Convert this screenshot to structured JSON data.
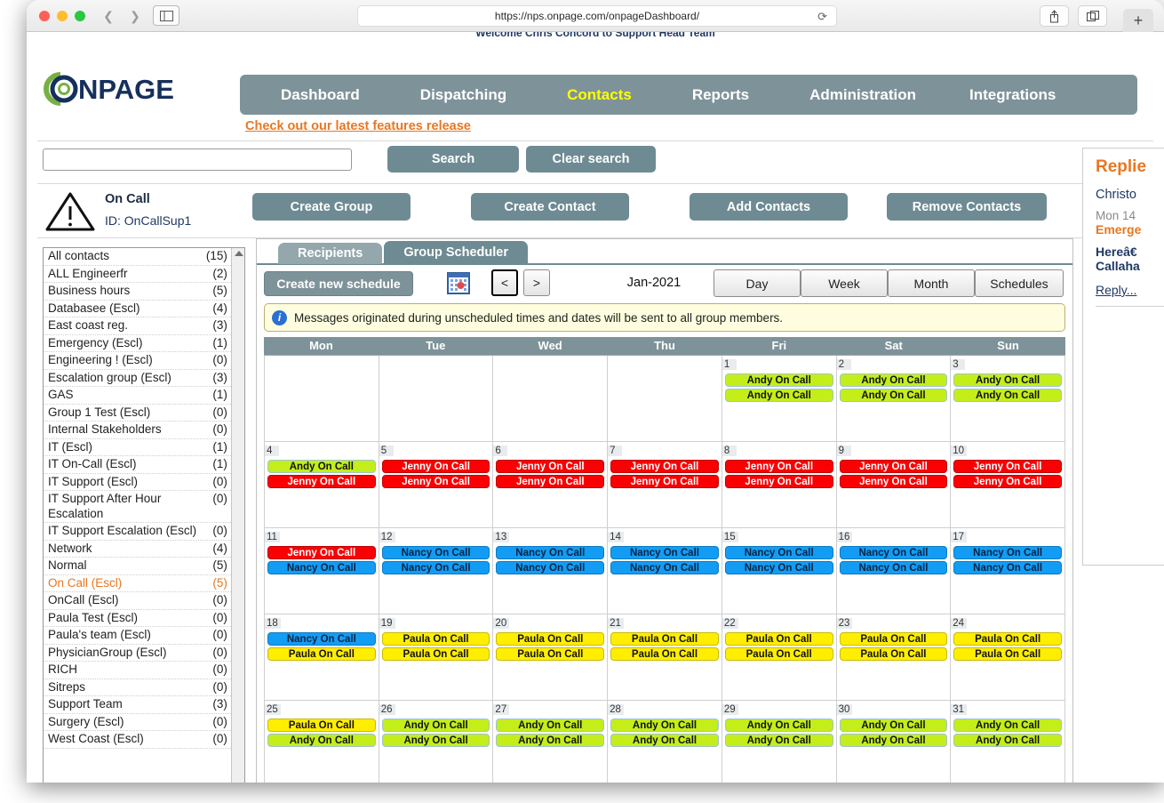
{
  "browser": {
    "url": "https://nps.onpage.com/onpageDashboard/",
    "back_icon": "chevron-left-icon",
    "forward_icon": "chevron-right-icon",
    "sidebar_icon": "sidebar-toggle-icon",
    "reload_icon": "reload-icon",
    "share_icon": "share-icon",
    "tabs_icon": "tab-overview-icon",
    "new_tab_label": "+"
  },
  "header": {
    "logo_text": "ONPAGE",
    "features_link": "Check out our latest features release",
    "nav": [
      {
        "label": "Dashboard",
        "active": false
      },
      {
        "label": "Dispatching",
        "active": false
      },
      {
        "label": "Contacts",
        "active": true
      },
      {
        "label": "Reports",
        "active": false
      },
      {
        "label": "Administration",
        "active": false
      },
      {
        "label": "Integrations",
        "active": false
      }
    ]
  },
  "search": {
    "value": "",
    "placeholder": "",
    "search_label": "Search",
    "clear_label": "Clear search"
  },
  "group_header": {
    "warning_icon": "warning-triangle-icon",
    "name": "On Call",
    "id": "ID: OnCallSup1",
    "buttons": [
      {
        "label": "Create Group"
      },
      {
        "label": "Create Contact"
      },
      {
        "label": "Add Contacts"
      },
      {
        "label": "Remove Contacts"
      }
    ]
  },
  "group_list": [
    {
      "name": "All contacts",
      "count": "(15)",
      "selected": false
    },
    {
      "name": "ALL Engineerfr",
      "count": "(2)",
      "selected": false
    },
    {
      "name": "Business hours",
      "count": "(5)",
      "selected": false
    },
    {
      "name": "Databasee (Escl)",
      "count": "(4)",
      "selected": false
    },
    {
      "name": "East coast reg.",
      "count": "(3)",
      "selected": false
    },
    {
      "name": "Emergency (Escl)",
      "count": "(1)",
      "selected": false
    },
    {
      "name": "Engineering ! (Escl)",
      "count": "(0)",
      "selected": false
    },
    {
      "name": "Escalation group (Escl)",
      "count": "(3)",
      "selected": false
    },
    {
      "name": "GAS",
      "count": "(1)",
      "selected": false
    },
    {
      "name": "Group 1 Test (Escl)",
      "count": "(0)",
      "selected": false
    },
    {
      "name": "Internal Stakeholders",
      "count": "(0)",
      "selected": false
    },
    {
      "name": "IT (Escl)",
      "count": "(1)",
      "selected": false
    },
    {
      "name": "IT On-Call (Escl)",
      "count": "(1)",
      "selected": false
    },
    {
      "name": "IT Support (Escl)",
      "count": "(0)",
      "selected": false
    },
    {
      "name": "IT Support After Hour Escalation",
      "count": "(0)",
      "selected": false
    },
    {
      "name": "IT Support Escalation (Escl)",
      "count": "(0)",
      "selected": false
    },
    {
      "name": "Network",
      "count": "(4)",
      "selected": false
    },
    {
      "name": "Normal",
      "count": "(5)",
      "selected": false
    },
    {
      "name": "On Call (Escl)",
      "count": "(5)",
      "selected": true
    },
    {
      "name": "OnCall (Escl)",
      "count": "(0)",
      "selected": false
    },
    {
      "name": "Paula Test (Escl)",
      "count": "(0)",
      "selected": false
    },
    {
      "name": "Paula's team (Escl)",
      "count": "(0)",
      "selected": false
    },
    {
      "name": "PhysicianGroup (Escl)",
      "count": "(0)",
      "selected": false
    },
    {
      "name": "RICH",
      "count": "(0)",
      "selected": false
    },
    {
      "name": "Sitreps",
      "count": "(0)",
      "selected": false
    },
    {
      "name": "Support Team",
      "count": "(3)",
      "selected": false
    },
    {
      "name": "Surgery (Escl)",
      "count": "(0)",
      "selected": false
    },
    {
      "name": "West Coast (Escl)",
      "count": "(0)",
      "selected": false
    }
  ],
  "tabs": [
    {
      "label": "Recipients",
      "active": false
    },
    {
      "label": "Group Scheduler",
      "active": true
    }
  ],
  "scheduler": {
    "create_new_schedule_label": "Create new schedule",
    "calendar_picker_icon": "calendar-picker-icon",
    "prev_label": "<",
    "next_label": ">",
    "month_label": "Jan-2021",
    "view_buttons": [
      {
        "label": "Day"
      },
      {
        "label": "Week"
      },
      {
        "label": "Month"
      },
      {
        "label": "Schedules"
      }
    ],
    "info_icon": "info-circle-icon",
    "info_text": "Messages originated during unscheduled times and dates will be sent to all group members.",
    "day_headers": [
      "Mon",
      "Tue",
      "Wed",
      "Thu",
      "Fri",
      "Sat",
      "Sun"
    ],
    "colors": {
      "andy": "#c3ee1a",
      "jenny": "#fb0003",
      "nancy": "#139cf4",
      "paula": "#ffee00",
      "header": "#7e9399",
      "accent": "#e87722"
    },
    "cells": [
      {
        "day": "",
        "events": []
      },
      {
        "day": "",
        "events": []
      },
      {
        "day": "",
        "events": []
      },
      {
        "day": "",
        "events": []
      },
      {
        "day": "1",
        "events": [
          {
            "label": "Andy On Call",
            "color": "green"
          },
          {
            "label": "Andy On Call",
            "color": "green"
          }
        ]
      },
      {
        "day": "2",
        "events": [
          {
            "label": "Andy On Call",
            "color": "green"
          },
          {
            "label": "Andy On Call",
            "color": "green"
          }
        ]
      },
      {
        "day": "3",
        "events": [
          {
            "label": "Andy On Call",
            "color": "green"
          },
          {
            "label": "Andy On Call",
            "color": "green"
          }
        ]
      },
      {
        "day": "4",
        "events": [
          {
            "label": "Andy On Call",
            "color": "green"
          },
          {
            "label": "Jenny On Call",
            "color": "red"
          }
        ]
      },
      {
        "day": "5",
        "events": [
          {
            "label": "Jenny On Call",
            "color": "red"
          },
          {
            "label": "Jenny On Call",
            "color": "red"
          }
        ]
      },
      {
        "day": "6",
        "events": [
          {
            "label": "Jenny On Call",
            "color": "red"
          },
          {
            "label": "Jenny On Call",
            "color": "red"
          }
        ]
      },
      {
        "day": "7",
        "events": [
          {
            "label": "Jenny On Call",
            "color": "red"
          },
          {
            "label": "Jenny On Call",
            "color": "red"
          }
        ]
      },
      {
        "day": "8",
        "events": [
          {
            "label": "Jenny On Call",
            "color": "red"
          },
          {
            "label": "Jenny On Call",
            "color": "red"
          }
        ]
      },
      {
        "day": "9",
        "events": [
          {
            "label": "Jenny On Call",
            "color": "red"
          },
          {
            "label": "Jenny On Call",
            "color": "red"
          }
        ]
      },
      {
        "day": "10",
        "events": [
          {
            "label": "Jenny On Call",
            "color": "red"
          },
          {
            "label": "Jenny On Call",
            "color": "red"
          }
        ]
      },
      {
        "day": "11",
        "events": [
          {
            "label": "Jenny On Call",
            "color": "red"
          },
          {
            "label": "Nancy On Call",
            "color": "blue"
          }
        ]
      },
      {
        "day": "12",
        "events": [
          {
            "label": "Nancy On Call",
            "color": "blue"
          },
          {
            "label": "Nancy On Call",
            "color": "blue"
          }
        ]
      },
      {
        "day": "13",
        "events": [
          {
            "label": "Nancy On Call",
            "color": "blue"
          },
          {
            "label": "Nancy On Call",
            "color": "blue"
          }
        ]
      },
      {
        "day": "14",
        "events": [
          {
            "label": "Nancy On Call",
            "color": "blue"
          },
          {
            "label": "Nancy On Call",
            "color": "blue"
          }
        ]
      },
      {
        "day": "15",
        "events": [
          {
            "label": "Nancy On Call",
            "color": "blue"
          },
          {
            "label": "Nancy On Call",
            "color": "blue"
          }
        ]
      },
      {
        "day": "16",
        "events": [
          {
            "label": "Nancy On Call",
            "color": "blue"
          },
          {
            "label": "Nancy On Call",
            "color": "blue"
          }
        ]
      },
      {
        "day": "17",
        "events": [
          {
            "label": "Nancy On Call",
            "color": "blue"
          },
          {
            "label": "Nancy On Call",
            "color": "blue"
          }
        ]
      },
      {
        "day": "18",
        "events": [
          {
            "label": "Nancy On Call",
            "color": "blue"
          },
          {
            "label": "Paula On Call",
            "color": "yellow"
          }
        ]
      },
      {
        "day": "19",
        "events": [
          {
            "label": "Paula On Call",
            "color": "yellow"
          },
          {
            "label": "Paula On Call",
            "color": "yellow"
          }
        ]
      },
      {
        "day": "20",
        "events": [
          {
            "label": "Paula On Call",
            "color": "yellow"
          },
          {
            "label": "Paula On Call",
            "color": "yellow"
          }
        ]
      },
      {
        "day": "21",
        "events": [
          {
            "label": "Paula On Call",
            "color": "yellow"
          },
          {
            "label": "Paula On Call",
            "color": "yellow"
          }
        ]
      },
      {
        "day": "22",
        "events": [
          {
            "label": "Paula On Call",
            "color": "yellow"
          },
          {
            "label": "Paula On Call",
            "color": "yellow"
          }
        ]
      },
      {
        "day": "23",
        "events": [
          {
            "label": "Paula On Call",
            "color": "yellow"
          },
          {
            "label": "Paula On Call",
            "color": "yellow"
          }
        ]
      },
      {
        "day": "24",
        "events": [
          {
            "label": "Paula On Call",
            "color": "yellow"
          },
          {
            "label": "Paula On Call",
            "color": "yellow"
          }
        ]
      },
      {
        "day": "25",
        "events": [
          {
            "label": "Paula On Call",
            "color": "yellow"
          },
          {
            "label": "Andy On Call",
            "color": "green"
          }
        ]
      },
      {
        "day": "26",
        "events": [
          {
            "label": "Andy On Call",
            "color": "green"
          },
          {
            "label": "Andy On Call",
            "color": "green"
          }
        ]
      },
      {
        "day": "27",
        "events": [
          {
            "label": "Andy On Call",
            "color": "green"
          },
          {
            "label": "Andy On Call",
            "color": "green"
          }
        ]
      },
      {
        "day": "28",
        "events": [
          {
            "label": "Andy On Call",
            "color": "green"
          },
          {
            "label": "Andy On Call",
            "color": "green"
          }
        ]
      },
      {
        "day": "29",
        "events": [
          {
            "label": "Andy On Call",
            "color": "green"
          },
          {
            "label": "Andy On Call",
            "color": "green"
          }
        ]
      },
      {
        "day": "30",
        "events": [
          {
            "label": "Andy On Call",
            "color": "green"
          },
          {
            "label": "Andy On Call",
            "color": "green"
          }
        ]
      },
      {
        "day": "31",
        "events": [
          {
            "label": "Andy On Call",
            "color": "green"
          },
          {
            "label": "Andy On Call",
            "color": "green"
          }
        ]
      }
    ]
  },
  "replies": {
    "title": "Replie",
    "sender": "Christo",
    "date": "Mon 14",
    "subject": "Emerge",
    "body_line_1": "Hereâ€",
    "body_line_2": "Callaha",
    "reply_link": "Reply..."
  }
}
